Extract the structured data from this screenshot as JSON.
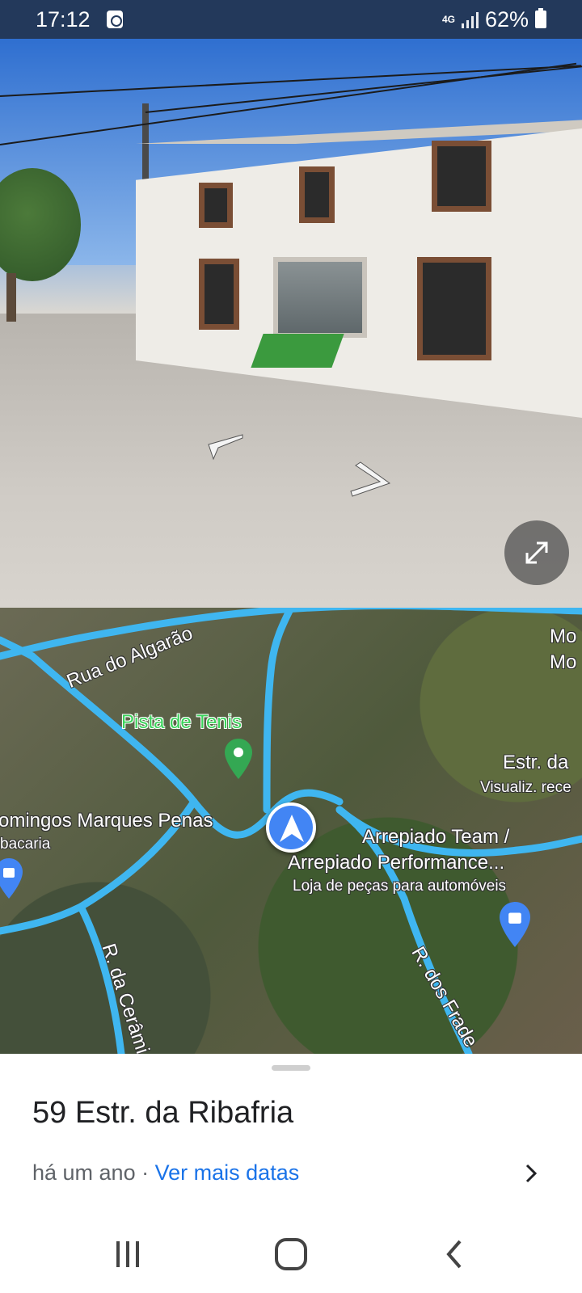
{
  "status_bar": {
    "time": "17:12",
    "network_type": "4G",
    "battery": "62%",
    "icons": [
      "alarm-icon",
      "signal-icon",
      "battery-icon"
    ]
  },
  "street_view": {
    "icons": [
      "arrow-left-icon",
      "arrow-right-icon",
      "expand-icon"
    ]
  },
  "map": {
    "labels": {
      "street_algarao": "Rua do Algarão",
      "poi_tennis": "Pista de Tenis",
      "poi_domingos": "omingos Marques Penas",
      "poi_domingos_sub": "bacaria",
      "poi_arrepiado_line1": "Arrepiado Team /",
      "poi_arrepiado_line2": "Arrepiado Performance...",
      "poi_arrepiado_sub": "Loja de peças para automóveis",
      "street_estr": "Estr. da",
      "street_estr_sub": "Visualiz. rece",
      "poi_mo1": "Mo",
      "poi_mo2": "Mo",
      "street_ceramica": "R. da Cerâmi",
      "street_frades": "R. dos Frade"
    },
    "colors": {
      "road": "#3fb6f0",
      "marker": "#4285f4",
      "poi_green": "#34a853"
    }
  },
  "sheet": {
    "title": "59 Estr. da Ribafria",
    "age": "há um ano",
    "separator": "·",
    "more_dates": "Ver mais datas"
  }
}
